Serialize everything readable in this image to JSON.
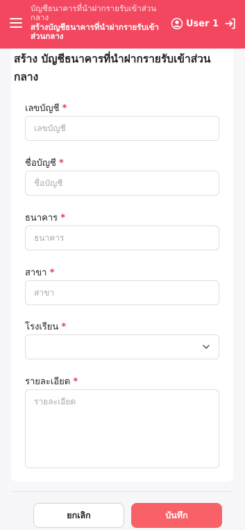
{
  "header": {
    "breadcrumb_parent": "บัญชีธนาคารที่นำฝากรายรับเข้าส่วนกลาง",
    "breadcrumb_current": "สร้างบัญชีธนาคารที่นำฝากรายรับเข้าส่วนกลาง",
    "user_name": "User 1",
    "menu_icon": "hamburger-icon",
    "user_icon": "user-circle-icon",
    "logout_icon": "logout-icon",
    "brand_color": "#f2475f"
  },
  "form": {
    "title": "สร้าง บัญชีธนาคารที่นำฝากรายรับเข้าส่วนกลาง",
    "required_mark": "*",
    "fields": {
      "account_number": {
        "label": "เลขบัญชี",
        "placeholder": "เลขบัญชี",
        "value": ""
      },
      "account_name": {
        "label": "ชื่อบัญชี",
        "placeholder": "ชื่อบัญชี",
        "value": ""
      },
      "bank": {
        "label": "ธนาคาร",
        "placeholder": "ธนาคาร",
        "value": ""
      },
      "branch": {
        "label": "สาขา",
        "placeholder": "สาขา",
        "value": ""
      },
      "school": {
        "label": "โรงเรียน",
        "selected": ""
      },
      "details": {
        "label": "รายละเอียด",
        "placeholder": "รายละเอียด",
        "value": ""
      }
    }
  },
  "actions": {
    "cancel_label": "ยกเลิก",
    "save_label": "บันทึก",
    "save_color": "#f86168"
  }
}
